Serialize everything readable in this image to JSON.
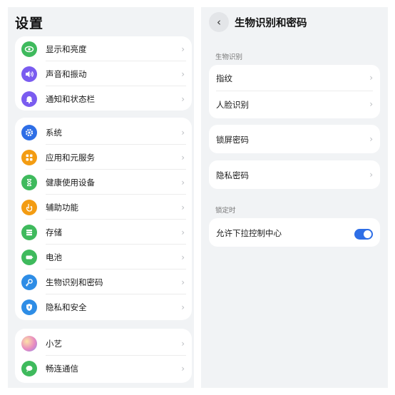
{
  "left": {
    "title": "设置",
    "groups": [
      [
        {
          "label": "显示和亮度",
          "icon": "eye-icon",
          "color": "#3fba5d"
        },
        {
          "label": "声音和振动",
          "icon": "speaker-icon",
          "color": "#7a5cf0"
        },
        {
          "label": "通知和状态栏",
          "icon": "bell-icon",
          "color": "#7a5cf0"
        }
      ],
      [
        {
          "label": "系统",
          "icon": "gear-icon",
          "color": "#2e6ee6"
        },
        {
          "label": "应用和元服务",
          "icon": "apps-grid-icon",
          "color": "#f39c12"
        },
        {
          "label": "健康使用设备",
          "icon": "hourglass-icon",
          "color": "#3fba5d"
        },
        {
          "label": "辅助功能",
          "icon": "hand-icon",
          "color": "#f39c12"
        },
        {
          "label": "存储",
          "icon": "storage-icon",
          "color": "#3fba5d"
        },
        {
          "label": "电池",
          "icon": "battery-icon",
          "color": "#3fba5d"
        },
        {
          "label": "生物识别和密码",
          "icon": "key-icon",
          "color": "#2e8de6"
        },
        {
          "label": "隐私和安全",
          "icon": "shield-icon",
          "color": "#2e8de6"
        }
      ],
      [
        {
          "label": "小艺",
          "icon": "assistant-orb-icon",
          "color": "#e88ac0"
        },
        {
          "label": "畅连通信",
          "icon": "chat-bubble-icon",
          "color": "#3fba5d"
        }
      ]
    ]
  },
  "right": {
    "back_icon": "chevron-left-icon",
    "title": "生物识别和密码",
    "section_biometrics": "生物识别",
    "fingerprint": "指纹",
    "face": "人脸识别",
    "lock_password": "锁屏密码",
    "privacy_password": "隐私密码",
    "section_locked": "锁定时",
    "allow_pull_down": "允许下拉控制中心",
    "allow_pull_down_on": true
  },
  "chevron": "›",
  "back_glyph": "‹"
}
